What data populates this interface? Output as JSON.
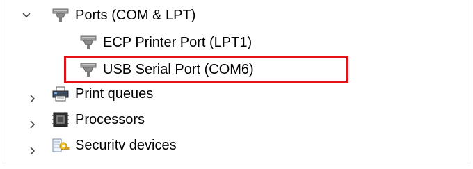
{
  "tree": {
    "ports": {
      "label": "Ports (COM & LPT)",
      "icon": "port-connector-icon",
      "expanded": true,
      "children": [
        {
          "label": "ECP Printer Port (LPT1)",
          "icon": "port-connector-icon"
        },
        {
          "label": "USB Serial Port (COM6)",
          "icon": "port-connector-icon",
          "highlighted": true
        }
      ]
    },
    "print_queues": {
      "label": "Print queues",
      "icon": "printer-icon",
      "expanded": false
    },
    "processors": {
      "label": "Processors",
      "icon": "processor-chip-icon",
      "expanded": false
    },
    "security_devices": {
      "label": "Securitv devices",
      "icon": "security-key-icon",
      "expanded": false
    }
  },
  "colors": {
    "highlight": "#e3121b",
    "chevron": "#4a4a4a",
    "port_icon": "#8c8c8c"
  }
}
